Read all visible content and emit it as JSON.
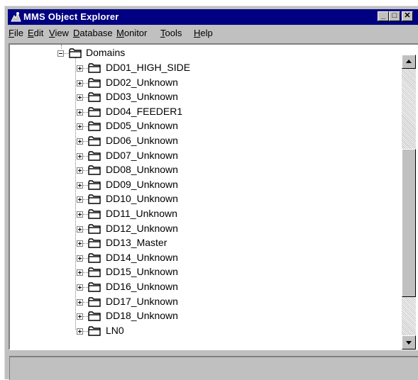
{
  "window": {
    "title": "MMS Object Explorer",
    "title_bar_color": "#000080",
    "buttons": {
      "minimize": "_",
      "maximize": "□",
      "close": "✕"
    }
  },
  "menubar": {
    "items": [
      {
        "label": "File",
        "mnemonic": "F",
        "rest": "ile"
      },
      {
        "label": "Edit",
        "mnemonic": "E",
        "rest": "dit"
      },
      {
        "label": "View",
        "mnemonic": "V",
        "rest": "iew"
      },
      {
        "label": "Database",
        "mnemonic": "D",
        "rest": "atabase"
      },
      {
        "label": "Monitor",
        "mnemonic": "M",
        "rest": "onitor"
      },
      {
        "label": "Tools",
        "mnemonic": "T",
        "rest": "ools"
      },
      {
        "label": "Help",
        "mnemonic": "H",
        "rest": "elp"
      }
    ]
  },
  "tree": {
    "root": {
      "label": "Domains",
      "expanded": true,
      "icon": "folder-icon"
    },
    "children": [
      {
        "label": "DD01_HIGH_SIDE",
        "icon": "folder-icon"
      },
      {
        "label": "DD02_Unknown",
        "icon": "folder-icon"
      },
      {
        "label": "DD03_Unknown",
        "icon": "folder-icon"
      },
      {
        "label": "DD04_FEEDER1",
        "icon": "folder-icon"
      },
      {
        "label": "DD05_Unknown",
        "icon": "folder-icon"
      },
      {
        "label": "DD06_Unknown",
        "icon": "folder-icon"
      },
      {
        "label": "DD07_Unknown",
        "icon": "folder-icon"
      },
      {
        "label": "DD08_Unknown",
        "icon": "folder-icon"
      },
      {
        "label": "DD09_Unknown",
        "icon": "folder-icon"
      },
      {
        "label": "DD10_Unknown",
        "icon": "folder-icon"
      },
      {
        "label": "DD11_Unknown",
        "icon": "folder-icon"
      },
      {
        "label": "DD12_Unknown",
        "icon": "folder-icon"
      },
      {
        "label": "DD13_Master",
        "icon": "folder-icon"
      },
      {
        "label": "DD14_Unknown",
        "icon": "folder-icon"
      },
      {
        "label": "DD15_Unknown",
        "icon": "folder-icon"
      },
      {
        "label": "DD16_Unknown",
        "icon": "folder-icon"
      },
      {
        "label": "DD17_Unknown",
        "icon": "folder-icon"
      },
      {
        "label": "DD18_Unknown",
        "icon": "folder-icon"
      },
      {
        "label": "LN0",
        "icon": "folder-icon"
      }
    ]
  },
  "status": {
    "text": ""
  }
}
